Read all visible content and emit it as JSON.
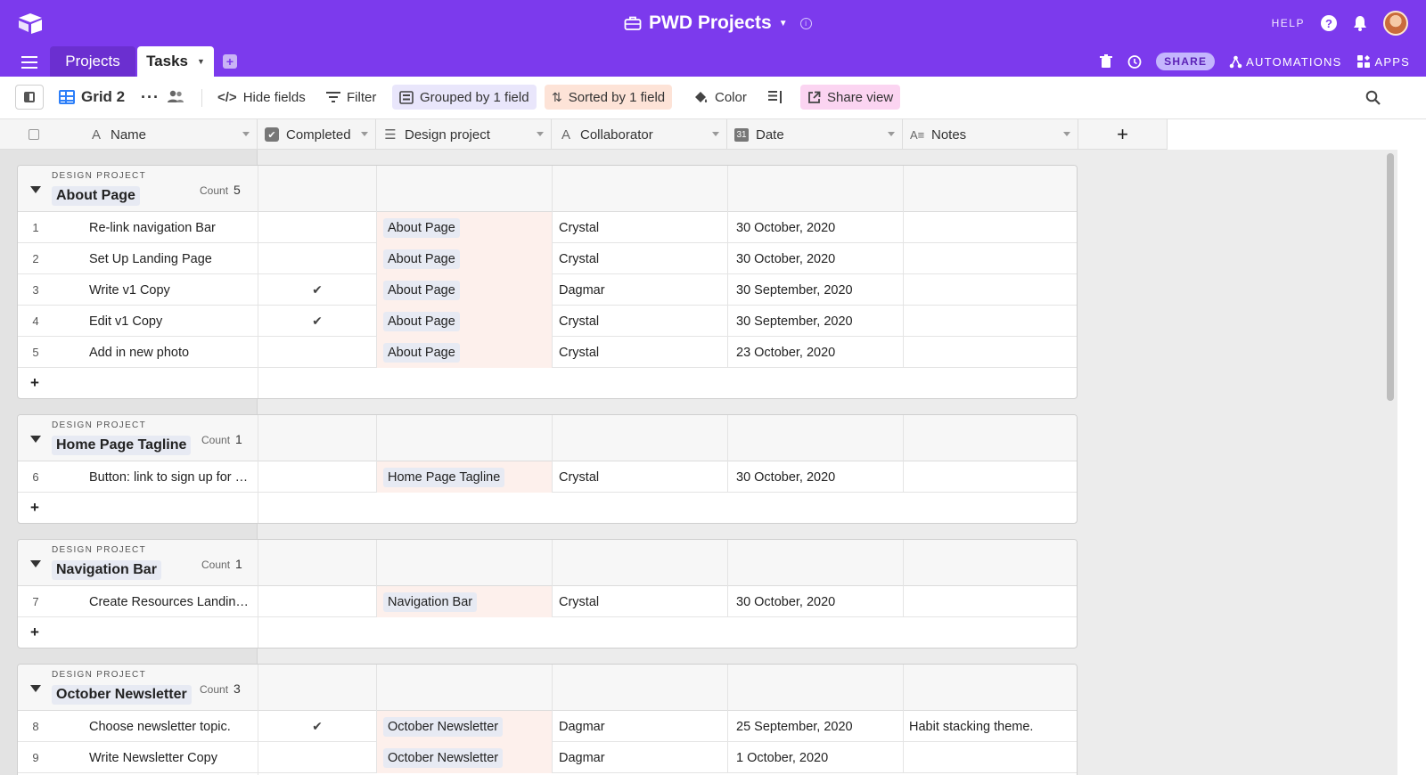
{
  "topbar": {
    "title": "PWD Projects",
    "help_label": "HELP",
    "help_icon": "?",
    "accent": "#7c3aed"
  },
  "tabs": [
    {
      "label": "Projects"
    },
    {
      "label": "Tasks"
    }
  ],
  "tabs_right": {
    "share_label": "SHARE",
    "automations_label": "AUTOMATIONS",
    "apps_label": "APPS"
  },
  "toolbar": {
    "view_name": "Grid 2",
    "hide_fields": "Hide fields",
    "filter": "Filter",
    "grouped": "Grouped by 1 field",
    "sorted": "Sorted by 1 field",
    "color": "Color",
    "share_view": "Share view"
  },
  "columns": {
    "name": "Name",
    "completed": "Completed",
    "design_project": "Design project",
    "collaborator": "Collaborator",
    "date": "Date",
    "notes": "Notes",
    "add": "+"
  },
  "group_type_label": "DESIGN PROJECT",
  "count_label": "Count",
  "groups": [
    {
      "name": "About Page",
      "count": "5",
      "rows": [
        {
          "num": "1",
          "name": "Re-link navigation Bar",
          "done": "",
          "project": "About Page",
          "collab": "Crystal",
          "date": "30 October, 2020",
          "notes": ""
        },
        {
          "num": "2",
          "name": "Set Up Landing Page",
          "done": "",
          "project": "About Page",
          "collab": "Crystal",
          "date": "30 October, 2020",
          "notes": ""
        },
        {
          "num": "3",
          "name": "Write v1 Copy",
          "done": "✔",
          "project": "About Page",
          "collab": "Dagmar",
          "date": "30 September, 2020",
          "notes": ""
        },
        {
          "num": "4",
          "name": "Edit v1 Copy",
          "done": "✔",
          "project": "About Page",
          "collab": "Crystal",
          "date": "30 September, 2020",
          "notes": ""
        },
        {
          "num": "5",
          "name": "Add in new photo",
          "done": "",
          "project": "About Page",
          "collab": "Crystal",
          "date": "23 October, 2020",
          "notes": ""
        }
      ]
    },
    {
      "name": "Home Page Tagline",
      "count": "1",
      "rows": [
        {
          "num": "6",
          "name": "Button: link to sign up for …",
          "done": "",
          "project": "Home Page Tagline",
          "collab": "Crystal",
          "date": "30 October, 2020",
          "notes": ""
        }
      ]
    },
    {
      "name": "Navigation Bar",
      "count": "1",
      "rows": [
        {
          "num": "7",
          "name": "Create Resources Landin…",
          "done": "",
          "project": "Navigation Bar",
          "collab": "Crystal",
          "date": "30 October, 2020",
          "notes": ""
        }
      ]
    },
    {
      "name": "October Newsletter",
      "count": "3",
      "rows": [
        {
          "num": "8",
          "name": "Choose newsletter topic.",
          "done": "✔",
          "project": "October Newsletter",
          "collab": "Dagmar",
          "date": "25 September, 2020",
          "notes": "Habit stacking theme."
        },
        {
          "num": "9",
          "name": "Write Newsletter Copy",
          "done": "",
          "project": "October Newsletter",
          "collab": "Dagmar",
          "date": "1 October, 2020",
          "notes": ""
        }
      ]
    }
  ]
}
